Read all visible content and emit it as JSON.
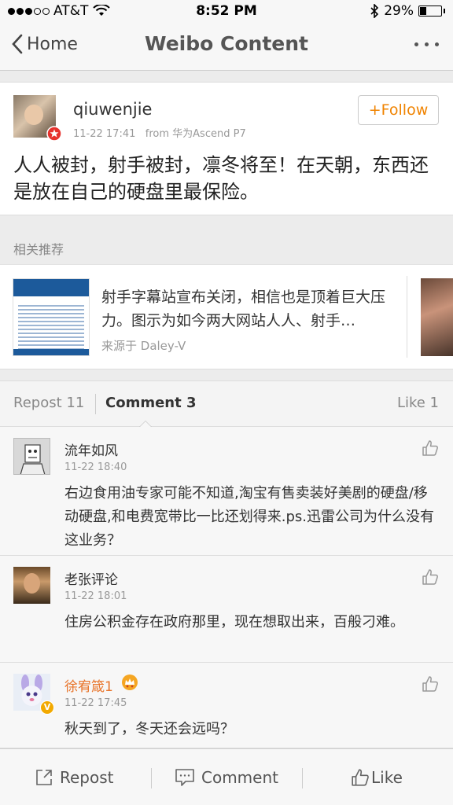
{
  "status_bar": {
    "carrier": "AT&T",
    "time": "8:52 PM",
    "battery": "29%",
    "battery_level": 0.29
  },
  "nav": {
    "back_label": "Home",
    "title": "Weibo Content"
  },
  "post": {
    "username": "qiuwenjie",
    "timestamp": "11-22 17:41",
    "source": "from 华为Ascend P7",
    "follow_label": "+Follow",
    "text": "人人被封，射手被封，凛冬将至！在天朝，东西还是放在自己的硬盘里最保险。"
  },
  "related": {
    "header": "相关推荐",
    "title": "射手字幕站宣布关闭，相信也是顶着巨大压力。图示为如今两大网站人人、射手…",
    "source": "来源于 Daley-V"
  },
  "tabs": {
    "repost": "Repost 11",
    "comment": "Comment 3",
    "like": "Like 1"
  },
  "comments": [
    {
      "name": "流年如风",
      "time": "11-22 18:40",
      "text": "右边食用油专家可能不知道,淘宝有售卖装好美剧的硬盘/移动硬盘,和电费宽带比一比还划得来.ps.迅雷公司为什么没有这业务？"
    },
    {
      "name": "老张评论",
      "time": "11-22 18:01",
      "text": "住房公积金存在政府那里，现在想取出来，百般刁难。"
    },
    {
      "name": "徐宥箴1",
      "time": "11-22 17:45",
      "text": "秋天到了，冬天还会远吗？"
    }
  ],
  "toolbar": {
    "repost": "Repost",
    "comment": "Comment",
    "like": "Like"
  },
  "colors": {
    "accent_orange": "#f08300",
    "tab_active": "#333333",
    "muted": "#999999"
  }
}
